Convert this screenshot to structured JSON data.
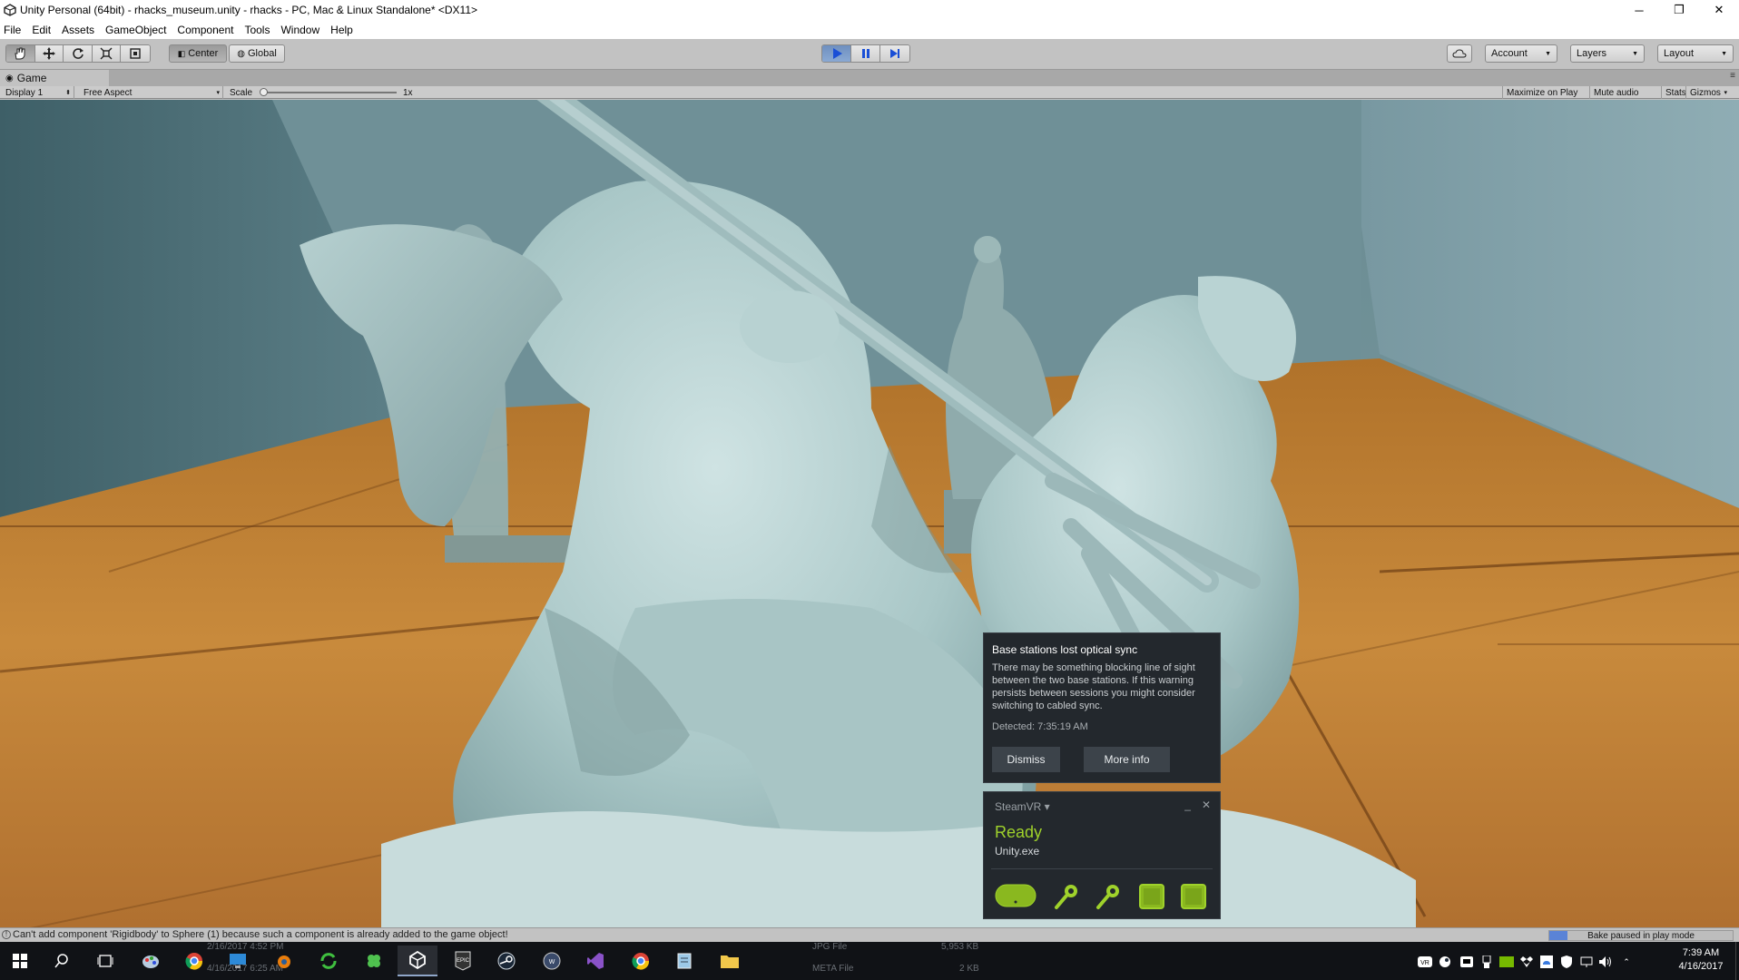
{
  "window": {
    "title": "Unity Personal (64bit) - rhacks_museum.unity - rhacks - PC, Mac & Linux Standalone* <DX11>",
    "minimize": "─",
    "restore": "❐",
    "close": "✕"
  },
  "menu": [
    "File",
    "Edit",
    "Assets",
    "GameObject",
    "Component",
    "Tools",
    "Window",
    "Help"
  ],
  "toolbar": {
    "tools": [
      "hand-tool",
      "move-tool",
      "rotate-tool",
      "scale-tool",
      "rect-tool"
    ],
    "pivot_label": "Center",
    "space_label": "Global",
    "play_controls": [
      "play",
      "pause",
      "step"
    ],
    "account_label": "Account",
    "layers_label": "Layers",
    "layout_label": "Layout"
  },
  "game_view": {
    "tab_label": "Game",
    "display": "Display 1",
    "aspect": "Free Aspect",
    "scale_label": "Scale",
    "scale_value": "1x",
    "maximize_on_play": "Maximize on Play",
    "mute_audio": "Mute audio",
    "stats": "Stats",
    "gizmos": "Gizmos"
  },
  "notification": {
    "title": "Base stations lost optical sync",
    "body": "There may be something blocking line of sight between the two base stations. If this warning persists between sessions you might consider switching to cabled sync.",
    "detected": "Detected: 7:35:19 AM",
    "dismiss_label": "Dismiss",
    "more_info_label": "More info"
  },
  "steamvr": {
    "header": "SteamVR ▾",
    "minimize": "_",
    "close": "✕",
    "status": "Ready",
    "app": "Unity.exe",
    "devices": [
      "headset-icon",
      "controller-icon",
      "controller-icon",
      "base-station-icon",
      "base-station-icon"
    ],
    "accent": "#9fd22b"
  },
  "status_bar": {
    "message": "Can't add component 'Rigidbody' to Sphere (1) because such a component is already added to the game object!",
    "bake_label": "Bake paused in play mode",
    "bake_progress": 0.1
  },
  "taskbar": {
    "ghost_text": [
      "JPG File",
      "META File",
      "5,953 KB",
      "2 KB",
      "2/16/2017 4:52 PM",
      "4/16/2017 6:25 AM"
    ],
    "time": "7:39 AM",
    "date": "4/16/2017"
  }
}
